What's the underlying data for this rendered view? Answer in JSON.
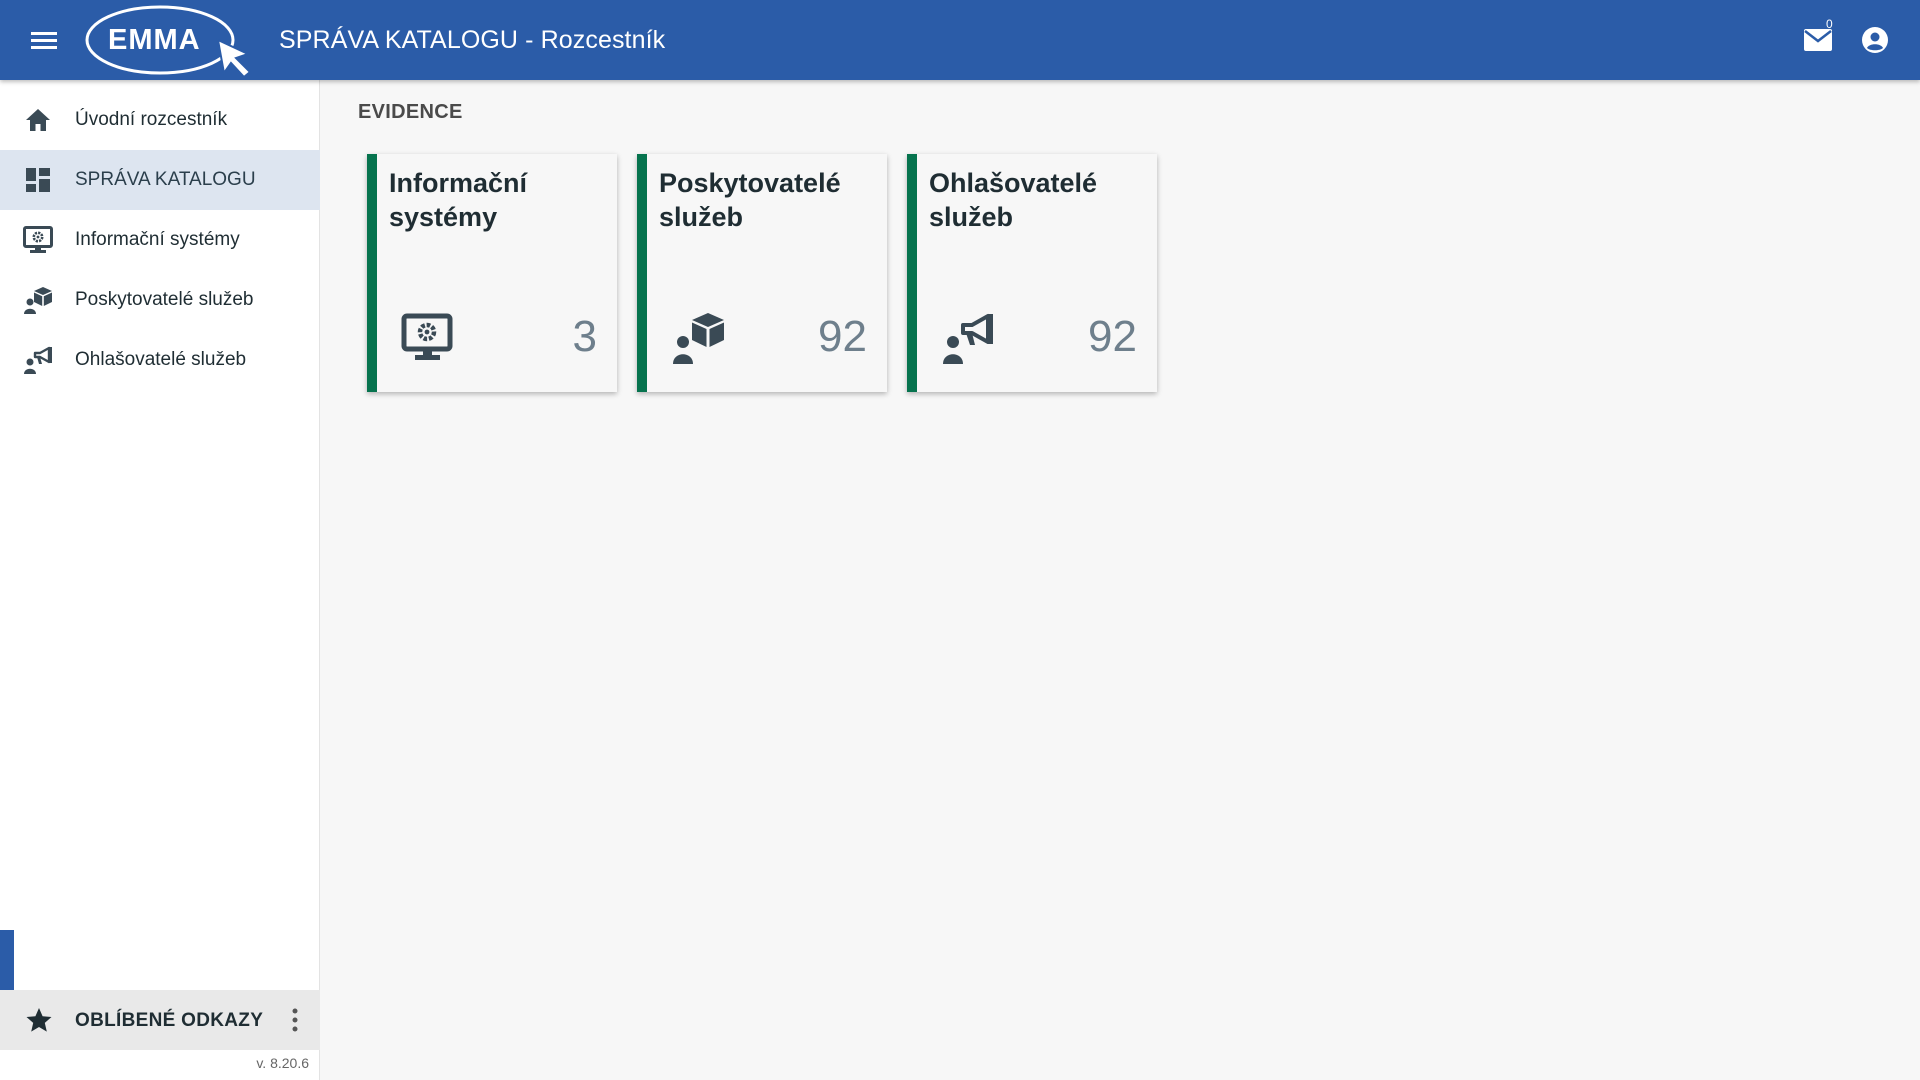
{
  "header": {
    "logo_text": "EMMA",
    "title": "SPRÁVA KATALOGU - Rozcestník",
    "mail_count": "0",
    "colors": {
      "bar": "#2b5ca8",
      "text": "#ffffff"
    },
    "icons": {
      "menu": "menu-icon",
      "mail": "mail-icon",
      "account": "account-circle-icon"
    }
  },
  "sidebar": {
    "items": [
      {
        "label": "Úvodní rozcestník",
        "icon": "home-icon",
        "active": false
      },
      {
        "label": "SPRÁVA KATALOGU",
        "icon": "dashboard-icon",
        "active": true
      },
      {
        "label": "Informační systémy",
        "icon": "monitor-gear-icon",
        "active": false
      },
      {
        "label": "Poskytovatelé služeb",
        "icon": "person-box-icon",
        "active": false
      },
      {
        "label": "Ohlašovatelé služeb",
        "icon": "person-megaphone-icon",
        "active": false
      }
    ],
    "favorites": {
      "label": "OBLÍBENÉ ODKAZY",
      "icon": "star-icon",
      "more_icon": "more-vert-icon"
    },
    "version": "v. 8.20.6"
  },
  "main": {
    "section_title": "EVIDENCE",
    "tiles": [
      {
        "title": "Informační systémy",
        "count": "3",
        "icon": "monitor-gear-icon"
      },
      {
        "title": "Poskytovatelé služeb",
        "count": "92",
        "icon": "person-box-icon"
      },
      {
        "title": "Ohlašovatelé služeb",
        "count": "92",
        "icon": "person-megaphone-icon"
      }
    ],
    "colors": {
      "tile_accent": "#06734e",
      "count_text": "#6e7f8c"
    }
  }
}
